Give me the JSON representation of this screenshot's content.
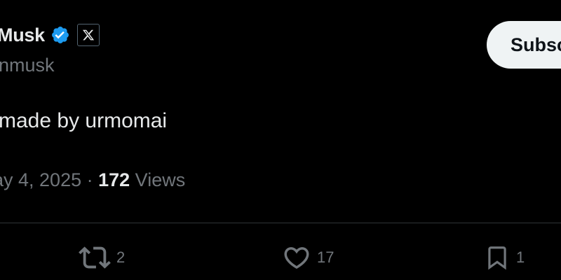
{
  "tweet": {
    "author_name": "Musk",
    "author_handle": "nmusk",
    "subscribe_label": "Subscribe",
    "text": "made by urmomai",
    "date": "ay 4, 2025",
    "separator": " · ",
    "views_count": "172",
    "views_label": " Views"
  },
  "actions": {
    "reposts": "2",
    "likes": "17",
    "bookmarks": "1"
  },
  "icons": {
    "verified": "verified-badge-icon",
    "affiliation": "x-logo-icon",
    "repost": "repost-icon",
    "like": "heart-icon",
    "bookmark": "bookmark-icon"
  },
  "colors": {
    "background": "#000000",
    "primary_text": "#e7e9ea",
    "secondary_text": "#71767b",
    "verified_blue": "#1d9bf0",
    "divider": "#2f3336",
    "subscribe_bg": "#eff3f4"
  }
}
